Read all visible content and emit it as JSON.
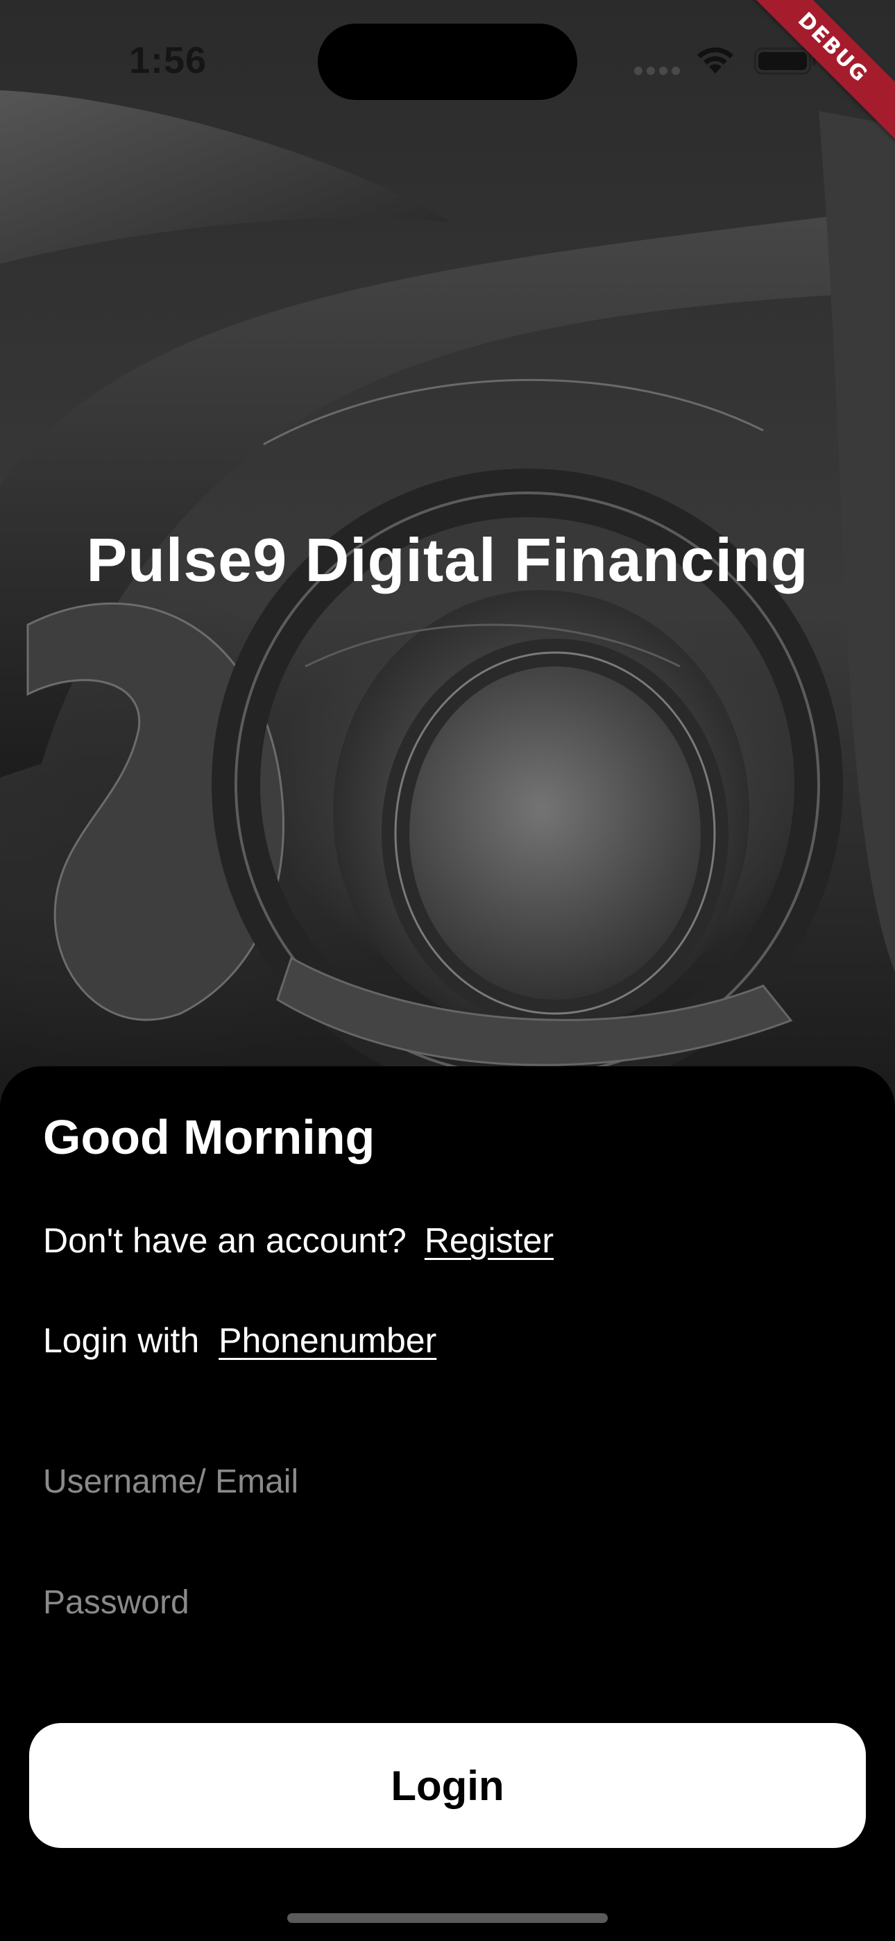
{
  "status_bar": {
    "time": "1:56"
  },
  "debug_banner": "DEBUG",
  "hero": {
    "title": "Pulse9 Digital Financing"
  },
  "sheet": {
    "greeting": "Good Morning",
    "register_prompt": "Don't have an account?",
    "register_link": "Register",
    "login_with_prefix": "Login with",
    "login_with_link": "Phonenumber",
    "username_placeholder": "Username/ Email",
    "password_placeholder": "Password",
    "login_button": "Login"
  },
  "colors": {
    "background": "#000000",
    "button_bg": "#ffffff",
    "placeholder": "#8a8a8a",
    "debug_ribbon": "#a51d2d"
  },
  "icons": [
    "wifi-icon",
    "battery-icon",
    "cellular-signal-icon"
  ]
}
